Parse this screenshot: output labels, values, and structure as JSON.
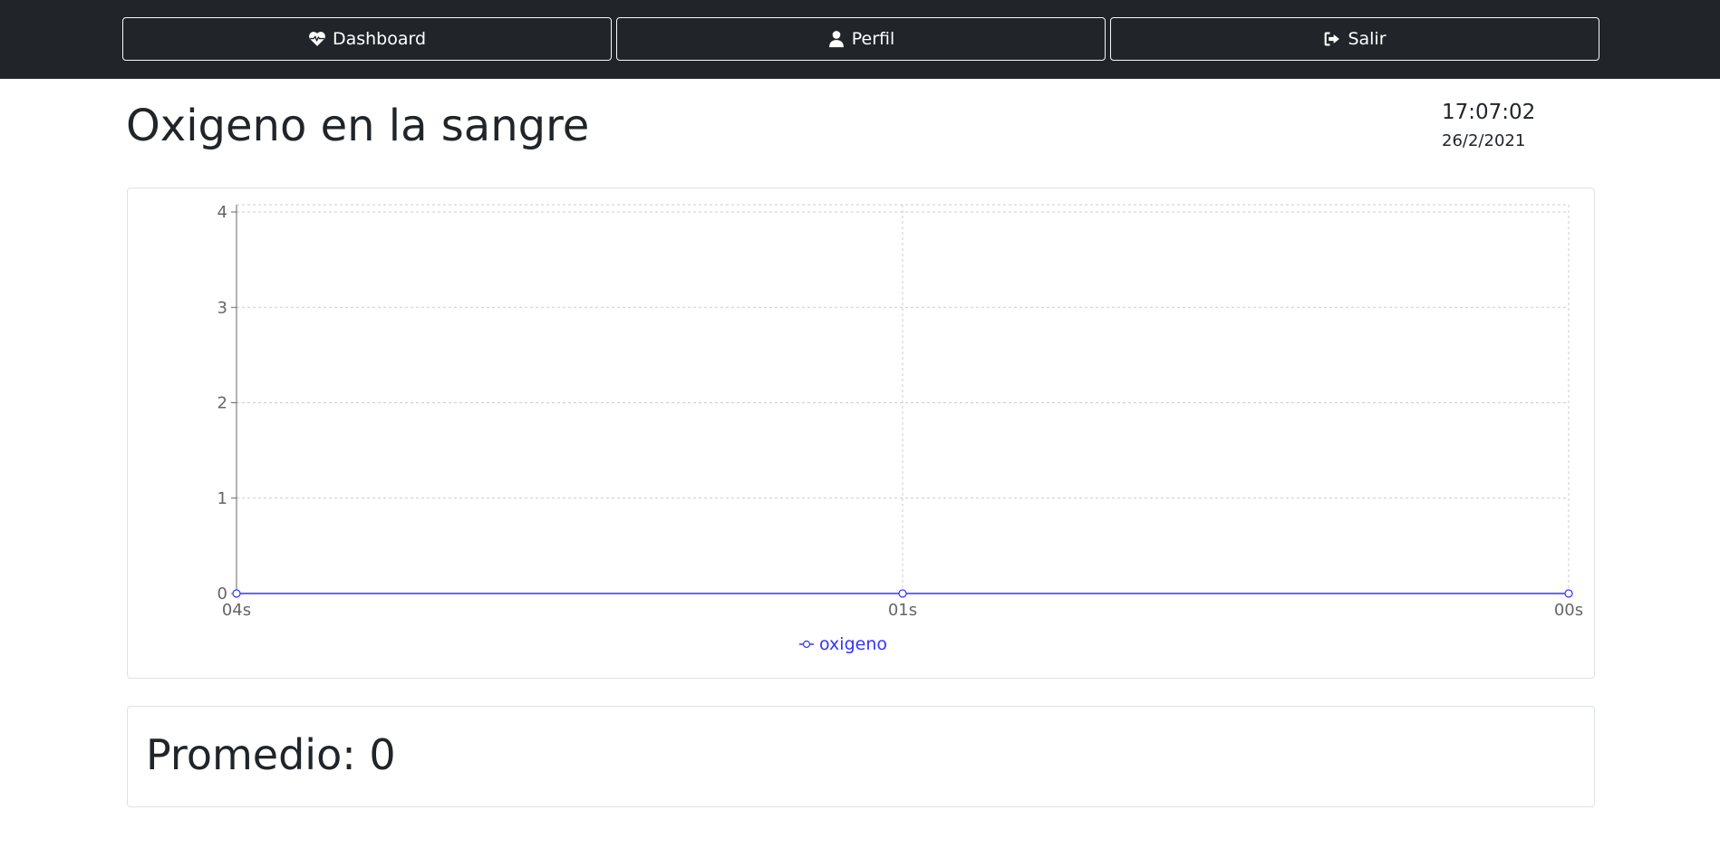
{
  "nav": {
    "dashboard_label": "Dashboard",
    "perfil_label": "Perfil",
    "salir_label": "Salir",
    "icons": {
      "dashboard": "heartbeat-icon",
      "perfil": "user-icon",
      "salir": "sign-out-icon"
    }
  },
  "header": {
    "title": "Oxigeno en la sangre",
    "time": "17:07:02",
    "date": "26/2/2021"
  },
  "chart_data": {
    "type": "line",
    "categories": [
      "04s",
      "01s",
      "00s"
    ],
    "series": [
      {
        "name": "oxigeno",
        "values": [
          0,
          0,
          0
        ],
        "color": "#3333ff"
      }
    ],
    "ylim": [
      0,
      4
    ],
    "yticks": [
      0,
      1,
      2,
      3,
      4
    ],
    "grid": true,
    "legend": "bottom",
    "title": "",
    "xlabel": "",
    "ylabel": ""
  },
  "summary": {
    "average_text": "Promedio: 0"
  }
}
